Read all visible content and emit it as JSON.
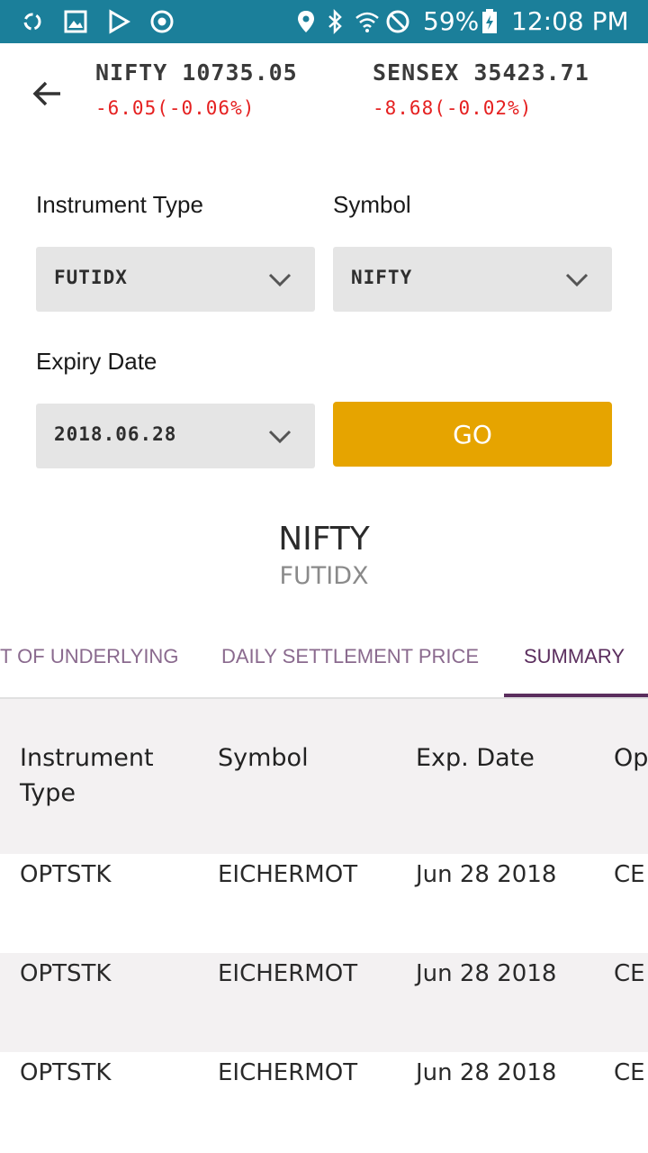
{
  "status_bar": {
    "battery": "59%",
    "time": "12:08 PM",
    "icons": [
      "sync-icon",
      "gallery-icon",
      "play-store-icon",
      "chrome-icon",
      "location-icon",
      "bluetooth-icon",
      "wifi-icon",
      "dnd-icon",
      "battery-icon"
    ]
  },
  "header": {
    "tickers": [
      {
        "name": "NIFTY 10735.05",
        "change": "-6.05(-0.06%)"
      },
      {
        "name": "SENSEX 35423.71",
        "change": "-8.68(-0.02%)"
      }
    ]
  },
  "form": {
    "instrument_type_label": "Instrument Type",
    "instrument_type_value": "FUTIDX",
    "symbol_label": "Symbol",
    "symbol_value": "NIFTY",
    "expiry_label": "Expiry Date",
    "expiry_value": "2018.06.28",
    "go_label": "GO"
  },
  "title": {
    "main": "NIFTY",
    "sub": "FUTIDX"
  },
  "tabs": [
    {
      "label": "T OF UNDERLYING",
      "active": false
    },
    {
      "label": "DAILY SETTLEMENT PRICE",
      "active": false
    },
    {
      "label": "SUMMARY",
      "active": true
    }
  ],
  "table": {
    "headers": [
      "Instrument Type",
      "Symbol",
      "Exp. Date",
      "Op"
    ],
    "rows": [
      [
        "OPTSTK",
        "EICHERMOT",
        "Jun 28 2018",
        "CE"
      ],
      [
        "OPTSTK",
        "EICHERMOT",
        "Jun 28 2018",
        "CE"
      ],
      [
        "OPTSTK",
        "EICHERMOT",
        "Jun 28 2018",
        "CE"
      ]
    ]
  },
  "colors": {
    "status_bar": "#1b7f9a",
    "negative": "#e52020",
    "go_button": "#e6a400",
    "accent_tab": "#5b2e5e"
  }
}
